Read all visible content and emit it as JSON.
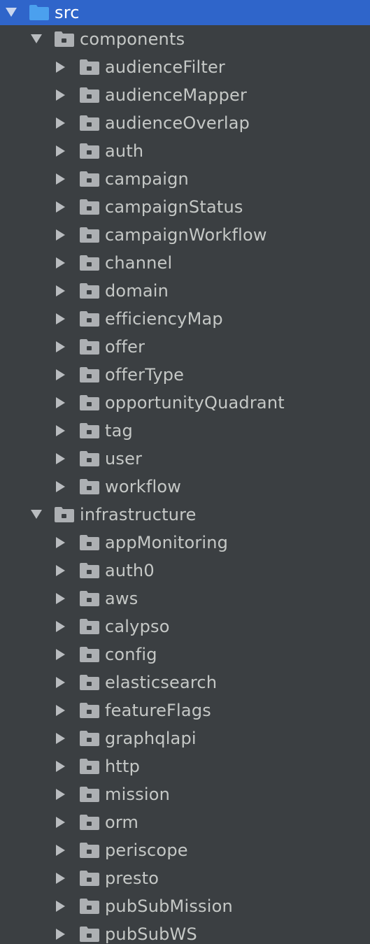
{
  "colors": {
    "background": "#3b3f42",
    "selection": "#2f65ca",
    "text": "#c5c8c6",
    "selected_text": "#ffffff",
    "folder": "#adb0b3",
    "source_folder": "#4ba0ee",
    "arrow": "#b9bcbf"
  },
  "root": {
    "label": "src",
    "icon": "source-folder-icon",
    "expanded": true,
    "selected": true
  },
  "components": {
    "label": "components",
    "icon": "folder-icon",
    "expanded": true,
    "children": [
      "audienceFilter",
      "audienceMapper",
      "audienceOverlap",
      "auth",
      "campaign",
      "campaignStatus",
      "campaignWorkflow",
      "channel",
      "domain",
      "efficiencyMap",
      "offer",
      "offerType",
      "opportunityQuadrant",
      "tag",
      "user",
      "workflow"
    ]
  },
  "infrastructure": {
    "label": "infrastructure",
    "icon": "folder-icon",
    "expanded": true,
    "children": [
      "appMonitoring",
      "auth0",
      "aws",
      "calypso",
      "config",
      "elasticsearch",
      "featureFlags",
      "graphqlapi",
      "http",
      "mission",
      "orm",
      "periscope",
      "presto",
      "pubSubMission",
      "pubSubWS"
    ]
  }
}
